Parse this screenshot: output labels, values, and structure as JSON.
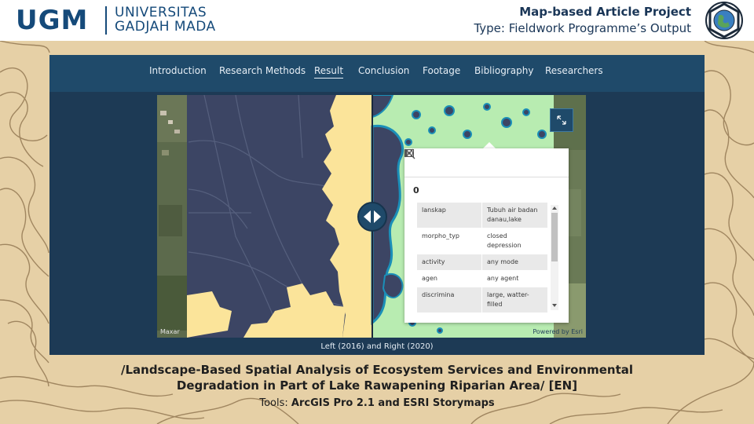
{
  "header": {
    "logo_short": "UGM",
    "university_line1": "UNIVERSITAS",
    "university_line2": "GADJAH MADA",
    "project_title": "Map-based Article Project",
    "project_type": "Type: Fieldwork Programme’s Output"
  },
  "nav": {
    "items": [
      {
        "label": "Introduction"
      },
      {
        "label": "Research Methods"
      },
      {
        "label": "Result",
        "active": true
      },
      {
        "label": "Conclusion"
      },
      {
        "label": "Footage"
      },
      {
        "label": "Bibliography"
      },
      {
        "label": "Researchers"
      }
    ]
  },
  "map": {
    "attribution_left": "Maxar",
    "attribution_right": "Powered by Esri",
    "caption": "Left (2016) and Right (2020)",
    "colors": {
      "water_2016": "#3c4564",
      "land_2016": "#fbe49a",
      "land_2020": "#b8ecb1",
      "water_2020": "#3c4564",
      "outline_2020": "#1b8fb8"
    }
  },
  "popup": {
    "title": "0",
    "rows": [
      {
        "key": "lanskap",
        "value": "Tubuh air badan danau,lake"
      },
      {
        "key": "morpho_typ",
        "value": "closed depression"
      },
      {
        "key": "activity",
        "value": "any mode"
      },
      {
        "key": "agen",
        "value": "any agent"
      },
      {
        "key": "discrimina",
        "value": "large, watter-filled"
      }
    ]
  },
  "article": {
    "title_line1": "/Landscape-Based Spatial Analysis of Ecosystem Services and Environmental",
    "title_line2": "Degradation in Part of Lake Rawapening Riparian Area/ [EN]",
    "tools_label": "Tools:",
    "tools_value": "ArcGIS Pro 2.1 and ESRI Storymaps"
  }
}
